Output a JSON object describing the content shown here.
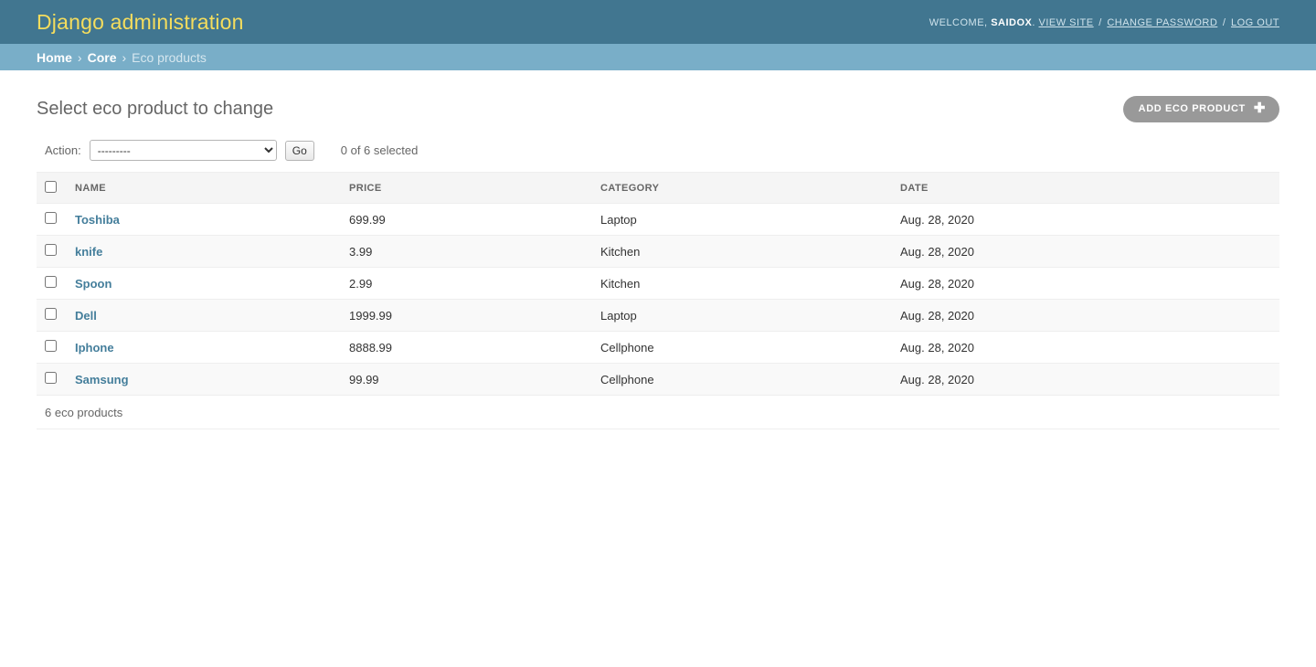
{
  "header": {
    "site_title": "Django administration",
    "welcome_prefix": "WELCOME,",
    "username": "SAIDOX",
    "username_suffix": ".",
    "view_site": "VIEW SITE",
    "change_password": "CHANGE PASSWORD",
    "log_out": "LOG OUT",
    "separator": "/",
    "bar_color": "#417690",
    "title_color": "#f5dd5d"
  },
  "breadcrumbs": {
    "home": "Home",
    "app": "Core",
    "current": "Eco products",
    "separator": "›",
    "bar_color": "#79aec8"
  },
  "page": {
    "title": "Select eco product to change",
    "add_button_label": "ADD ECO PRODUCT",
    "add_button_icon": "plus-icon",
    "add_button_color": "#999999"
  },
  "actions": {
    "label": "Action:",
    "selected_option": "---------",
    "options": [
      "---------"
    ],
    "go_label": "Go",
    "counter": "0 of 6 selected"
  },
  "table": {
    "columns": [
      "NAME",
      "PRICE",
      "CATEGORY",
      "DATE"
    ],
    "rows": [
      {
        "name": "Toshiba",
        "price": "699.99",
        "category": "Laptop",
        "date": "Aug. 28, 2020"
      },
      {
        "name": "knife",
        "price": "3.99",
        "category": "Kitchen",
        "date": "Aug. 28, 2020"
      },
      {
        "name": "Spoon",
        "price": "2.99",
        "category": "Kitchen",
        "date": "Aug. 28, 2020"
      },
      {
        "name": "Dell",
        "price": "1999.99",
        "category": "Laptop",
        "date": "Aug. 28, 2020"
      },
      {
        "name": "Iphone",
        "price": "8888.99",
        "category": "Cellphone",
        "date": "Aug. 28, 2020"
      },
      {
        "name": "Samsung",
        "price": "99.99",
        "category": "Cellphone",
        "date": "Aug. 28, 2020"
      }
    ],
    "link_color": "#447e9b"
  },
  "footer": {
    "result_count": "6 eco products"
  }
}
